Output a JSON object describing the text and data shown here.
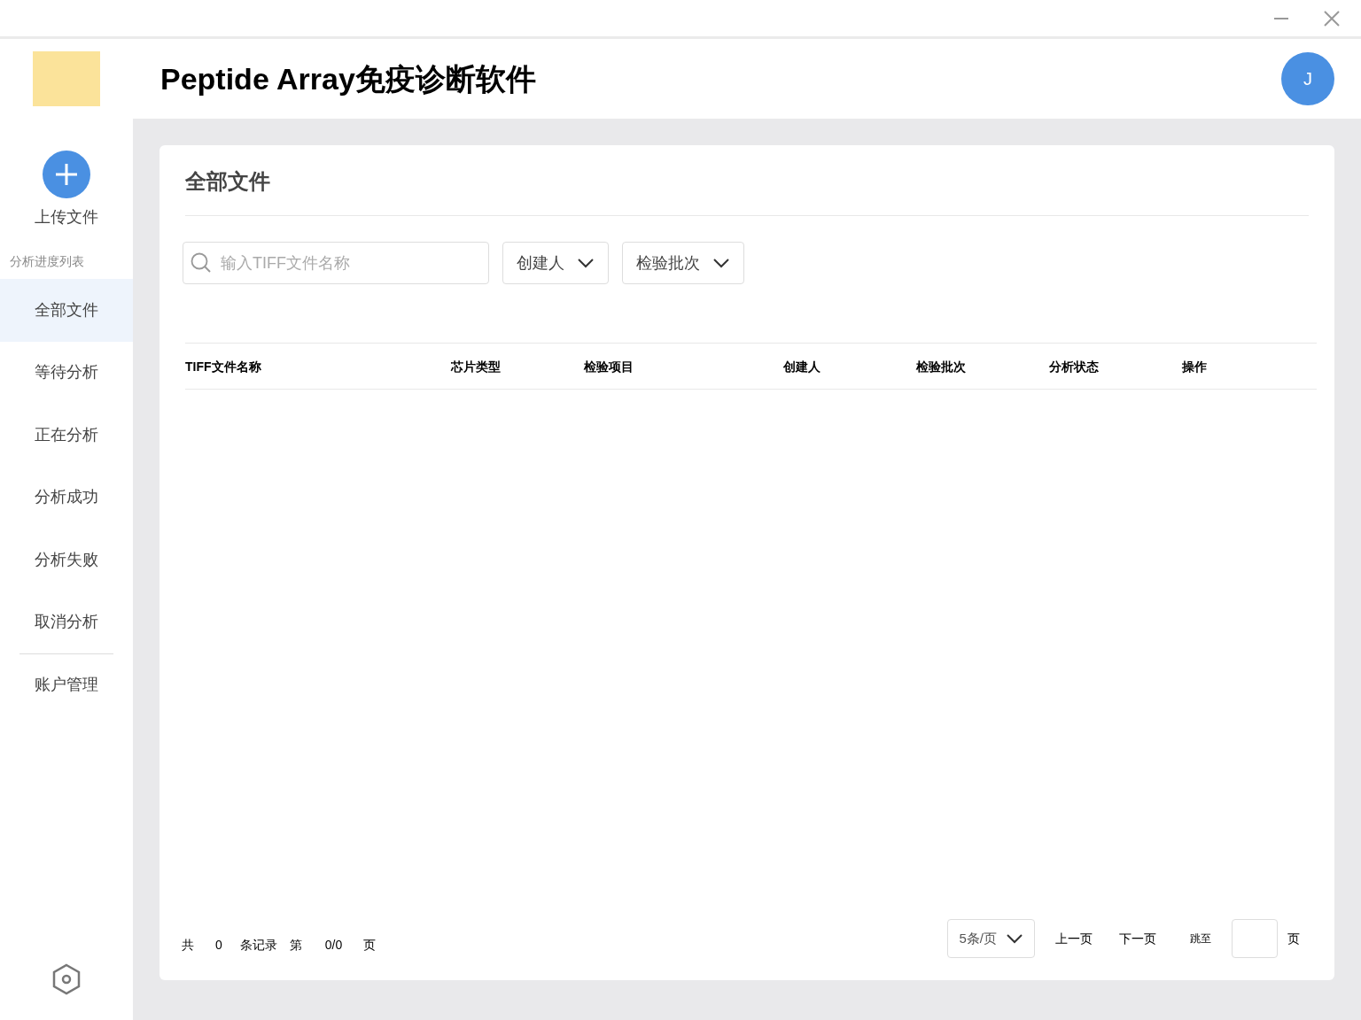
{
  "header": {
    "title": "Peptide Array免疫诊断软件",
    "avatar": "J"
  },
  "sidebar": {
    "upload": "上传文件",
    "section": "分析进度列表",
    "items": [
      {
        "label": "全部文件",
        "selected": true
      },
      {
        "label": "等待分析",
        "selected": false
      },
      {
        "label": "正在分析",
        "selected": false
      },
      {
        "label": "分析成功",
        "selected": false
      },
      {
        "label": "分析失败",
        "selected": false
      },
      {
        "label": "取消分析",
        "selected": false
      }
    ],
    "footer_items": [
      {
        "label": "账户管理",
        "selected": false
      }
    ]
  },
  "card": {
    "title": "全部文件",
    "search": {
      "placeholder": "输入TIFF文件名称"
    },
    "filters": [
      "创建人",
      "检验批次"
    ],
    "table": {
      "columns": [
        "TIFF文件名称",
        "芯片类型",
        "检验项目",
        "创建人",
        "检验批次",
        "分析状态",
        "操作"
      ]
    },
    "pagination": {
      "summary": [
        "共",
        "0",
        "条记录",
        "第",
        "0/0",
        "页"
      ],
      "page_size": "5条/页",
      "prev": "上一页",
      "next": "下一页",
      "jump_label": "跳至",
      "jump_suffix": "页"
    }
  }
}
